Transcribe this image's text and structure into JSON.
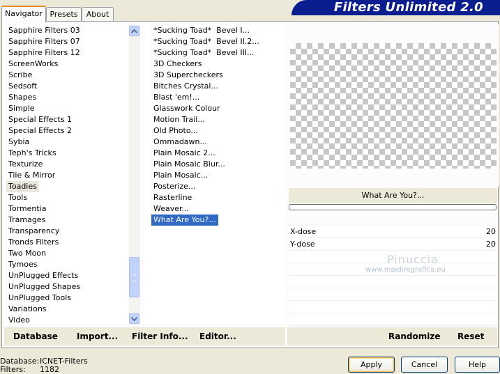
{
  "tabs": [
    "Navigator",
    "Presets",
    "About"
  ],
  "banner_title": "Filters Unlimited 2.0",
  "categories": {
    "items": [
      "Sapphire Filters 03",
      "Sapphire Filters 07",
      "Sapphire Filters 12",
      "ScreenWorks",
      "Scribe",
      "Sedsoft",
      "Shapes",
      "Simple",
      "Special Effects 1",
      "Special Effects 2",
      "Sybia",
      "Teph's Tricks",
      "Texturize",
      "Tile & Mirror",
      "Toadies",
      "Tools",
      "Tormentia",
      "Tramages",
      "Transparency",
      "Tronds Filters",
      "Two Moon",
      "Tymoes",
      "UnPlugged Effects",
      "UnPlugged Shapes",
      "UnPlugged Tools",
      "Variations",
      "Video"
    ],
    "selected": "Toadies"
  },
  "filters": {
    "items": [
      "*Sucking Toad*  Bevel I...",
      "*Sucking Toad*  Bevel II.2...",
      "*Sucking Toad*  Bevel III...",
      "3D Checkers",
      "3D Supercheckers",
      "Bitches Crystal...",
      "Blast 'em!...",
      "Glasswork Colour",
      "Motion Trail...",
      "Old Photo...",
      "Ommadawn...",
      "Plain Mosaic 2...",
      "Plain Mosaic Blur...",
      "Plain Mosaic...",
      "Posterize...",
      "Rasterline",
      "Weaver...",
      "What Are You?..."
    ],
    "selected": "What Are You?..."
  },
  "filter_name": "What Are You?...",
  "params": [
    {
      "label": "X-dose",
      "value": "20"
    },
    {
      "label": "Y-dose",
      "value": "20"
    }
  ],
  "watermark": {
    "name": "Pinuccia",
    "url": "www.maidiregrafica.eu"
  },
  "bottom_buttons": {
    "database": "Database",
    "import": "Import...",
    "filter_info": "Filter Info...",
    "editor": "Editor...",
    "randomize": "Randomize",
    "reset": "Reset"
  },
  "status": {
    "database_label": "Database:",
    "database_value": "ICNET-Filters",
    "filters_label": "Filters:",
    "filters_value": "1182"
  },
  "dialog_buttons": {
    "apply": "Apply",
    "cancel": "Cancel",
    "help": "Help"
  },
  "colors": {
    "banner": "#0a1e8f",
    "selection": "#316ac5",
    "tab_accent": "#e68b2c"
  }
}
